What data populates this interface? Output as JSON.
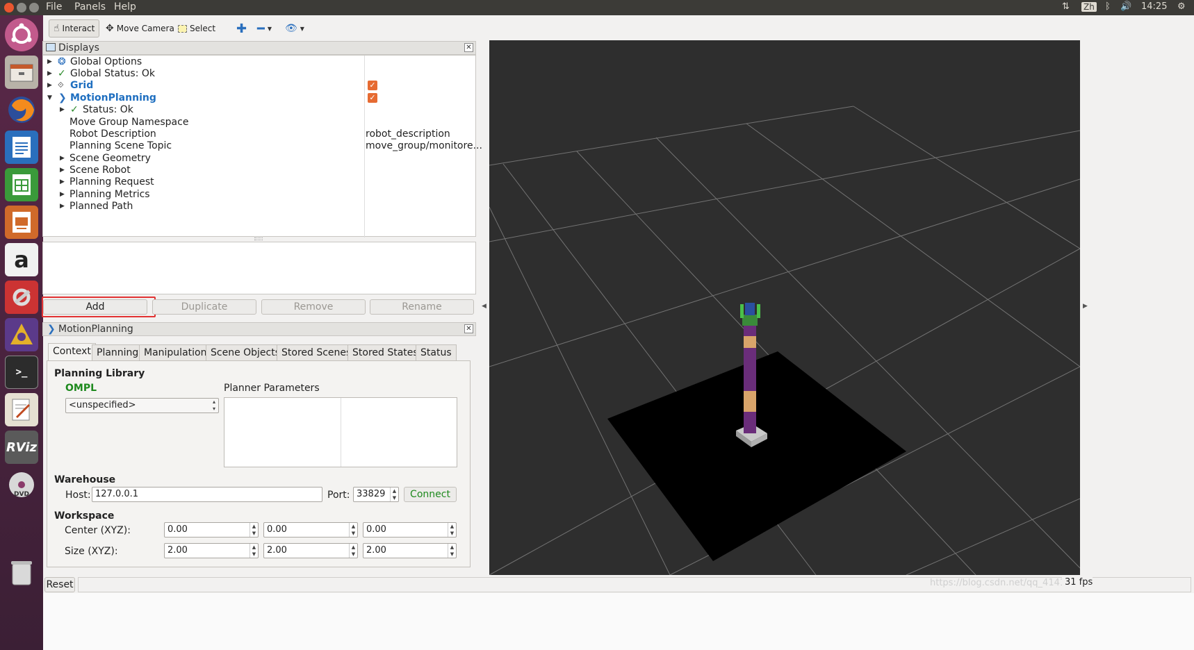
{
  "topbar": {
    "menu": [
      "File",
      "Panels",
      "Help"
    ],
    "lang": "Zh",
    "time": "14:25"
  },
  "toolbar": {
    "interact": "Interact",
    "move_camera": "Move Camera",
    "select": "Select"
  },
  "displays": {
    "title": "Displays",
    "items": [
      {
        "label": "Global Options",
        "value": ""
      },
      {
        "label": "Global Status: Ok",
        "value": ""
      },
      {
        "label": "Grid",
        "value": ""
      },
      {
        "label": "MotionPlanning",
        "value": ""
      },
      {
        "label": "Status: Ok",
        "value": ""
      },
      {
        "label": "Move Group Namespace",
        "value": ""
      },
      {
        "label": "Robot Description",
        "value": "robot_description"
      },
      {
        "label": "Planning Scene Topic",
        "value": "move_group/monitore..."
      },
      {
        "label": "Scene Geometry",
        "value": ""
      },
      {
        "label": "Scene Robot",
        "value": ""
      },
      {
        "label": "Planning Request",
        "value": ""
      },
      {
        "label": "Planning Metrics",
        "value": ""
      },
      {
        "label": "Planned Path",
        "value": ""
      }
    ]
  },
  "buttons": {
    "add": "Add",
    "duplicate": "Duplicate",
    "remove": "Remove",
    "rename": "Rename"
  },
  "motion_planning": {
    "title": "MotionPlanning",
    "tabs": [
      "Context",
      "Planning",
      "Manipulation",
      "Scene Objects",
      "Stored Scenes",
      "Stored States",
      "Status"
    ],
    "planning_library": "Planning Library",
    "library_name": "OMPL",
    "planner_select": "<unspecified>",
    "planner_parameters": "Planner Parameters",
    "warehouse": "Warehouse",
    "host_label": "Host:",
    "host_value": "127.0.0.1",
    "port_label": "Port:",
    "port_value": "33829",
    "connect": "Connect",
    "workspace": "Workspace",
    "center_label": "Center (XYZ):",
    "center_values": [
      "0.00",
      "0.00",
      "0.00"
    ],
    "size_label": "Size (XYZ):",
    "size_values": [
      "2.00",
      "2.00",
      "2.00"
    ]
  },
  "statusbar": {
    "reset": "Reset",
    "watermark": "https://blog.csdn.net/qq_4141",
    "fps": "31 fps"
  }
}
